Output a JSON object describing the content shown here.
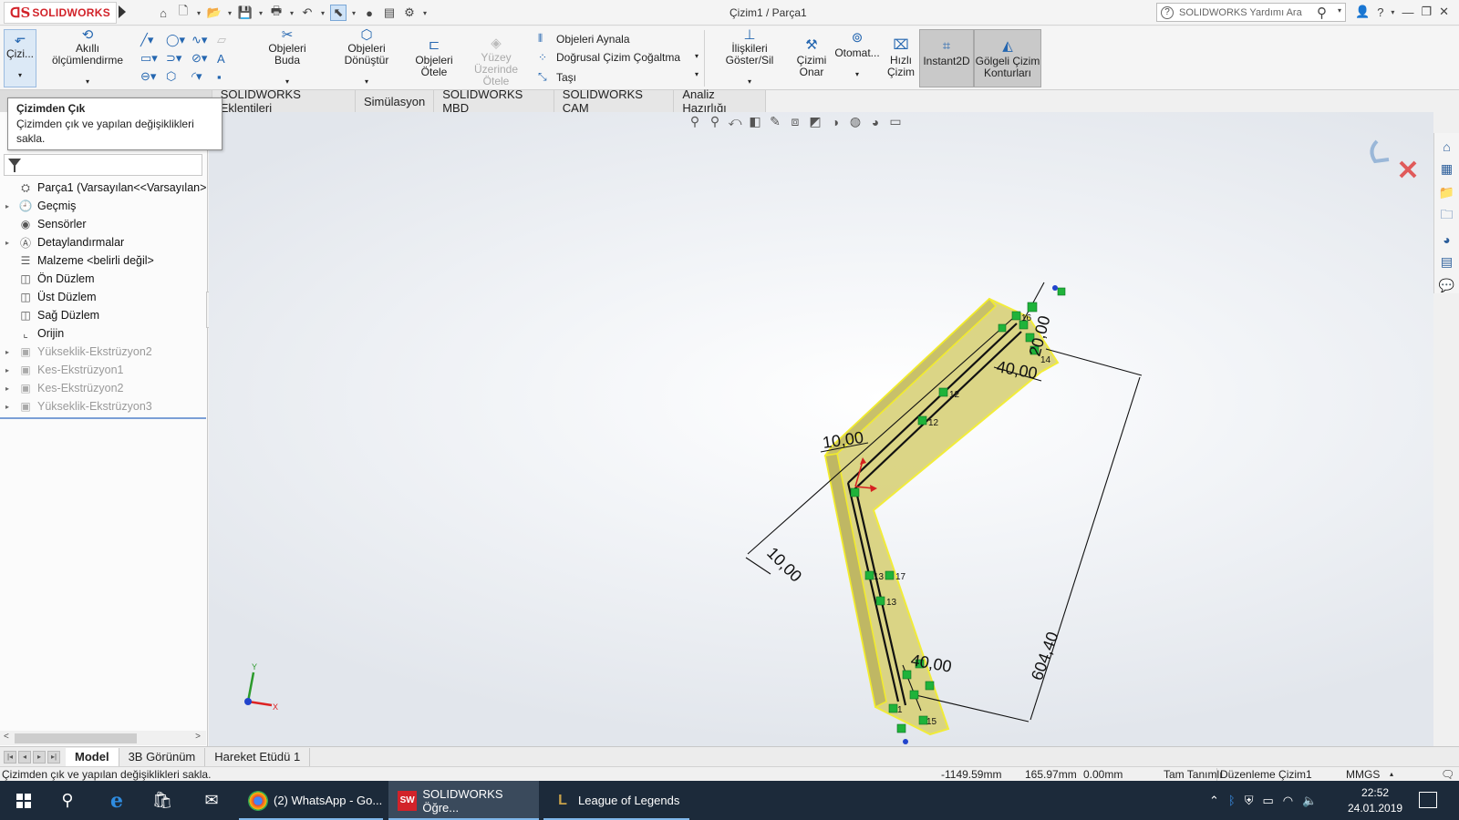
{
  "titlebar": {
    "logo_text": "SOLIDWORKS",
    "doc_title": "Çizim1 / Parça1",
    "help_search_placeholder": "SOLIDWORKS Yardımı Ara"
  },
  "command_manager": {
    "exit_sketch": "Çizi...",
    "smart_dimension": "Akıllı ölçümlendirme",
    "trim": "Objeleri Buda",
    "convert": "Objeleri Dönüştür",
    "offset_line1": "Objeleri",
    "offset_line2": "Ötele",
    "surface_offset_line1": "Yüzey Üzerinde",
    "surface_offset_line2": "Ötele",
    "mirror": "Objeleri Aynala",
    "linear_pattern": "Doğrusal Çizim Çoğaltma",
    "move": "Taşı",
    "show_relations": "İlişkileri Göster/Sil",
    "repair_line1": "Çizimi",
    "repair_line2": "Onar",
    "auto": "Otomat...",
    "quick_line1": "Hızlı",
    "quick_line2": "Çizim",
    "instant2d": "Instant2D",
    "shaded_line1": "Gölgeli Çizim",
    "shaded_line2": "Konturları"
  },
  "tabs": [
    "SOLIDWORKS Eklentileri",
    "Simülasyon",
    "SOLIDWORKS MBD",
    "SOLIDWORKS CAM",
    "Analiz Hazırlığı"
  ],
  "tooltip": {
    "title": "Çizimden Çık",
    "body": "Çizimden çık ve yapılan değişiklikleri sakla."
  },
  "feature_tree": [
    {
      "label": "Parça1  (Varsayılan<<Varsayılan>",
      "icon": "part-icon",
      "expand": false,
      "dim": false
    },
    {
      "label": "Geçmiş",
      "icon": "history-icon",
      "expand": true,
      "dim": false
    },
    {
      "label": "Sensörler",
      "icon": "sensor-icon",
      "expand": false,
      "dim": false
    },
    {
      "label": "Detaylandırmalar",
      "icon": "annotation-icon",
      "expand": true,
      "dim": false
    },
    {
      "label": "Malzeme <belirli değil>",
      "icon": "material-icon",
      "expand": false,
      "dim": false
    },
    {
      "label": "Ön Düzlem",
      "icon": "plane-icon",
      "expand": false,
      "dim": false
    },
    {
      "label": "Üst Düzlem",
      "icon": "plane-icon",
      "expand": false,
      "dim": false
    },
    {
      "label": "Sağ Düzlem",
      "icon": "plane-icon",
      "expand": false,
      "dim": false
    },
    {
      "label": "Orijin",
      "icon": "origin-icon",
      "expand": false,
      "dim": false
    },
    {
      "label": "Yükseklik-Ekstrüzyon2",
      "icon": "extrude-icon",
      "expand": true,
      "dim": true
    },
    {
      "label": "Kes-Ekstrüzyon1",
      "icon": "cut-icon",
      "expand": true,
      "dim": true
    },
    {
      "label": "Kes-Ekstrüzyon2",
      "icon": "cut-icon",
      "expand": true,
      "dim": true
    },
    {
      "label": "Yükseklik-Ekstrüzyon3",
      "icon": "extrude-icon",
      "expand": true,
      "dim": true
    }
  ],
  "dimensions": {
    "d1": "10,00",
    "d2": "10,00",
    "d3": "40,00",
    "d4": "20,00",
    "d5": "40,00",
    "d6": "604,40"
  },
  "relation_labels": {
    "r12a": "12",
    "r12b": "12",
    "r13a": "13",
    "r17": "17",
    "r13b": "13",
    "r16": "16",
    "r14": "14",
    "r1": "1",
    "r15": "15"
  },
  "triad": {
    "x": "X",
    "y": "Y"
  },
  "bottom_tabs": [
    "Model",
    "3B Görünüm",
    "Hareket Etüdü 1"
  ],
  "statusbar": {
    "message": "Çizimden çık ve yapılan değişiklikleri sakla.",
    "x": "-1149.59mm",
    "y": "165.97mm",
    "z": "0.00mm",
    "state": "Tam Tanımlı",
    "mode": "Düzenleme Çizim1",
    "units": "MMGS"
  },
  "taskbar": {
    "apps": [
      {
        "label": "(2) WhatsApp - Go...",
        "icon": "chrome-icon"
      },
      {
        "label": "SOLIDWORKS Öğre...",
        "icon": "solidworks-icon"
      },
      {
        "label": "League of Legends",
        "icon": "league-icon"
      }
    ],
    "time": "22:52",
    "date": "24.01.2019"
  },
  "colors": {
    "part_fill": "#d9d27c",
    "part_edge": "#f2ec2a",
    "sketch_line": "#111111",
    "relation_green": "#1fb33a",
    "brand_red": "#d2232a"
  }
}
